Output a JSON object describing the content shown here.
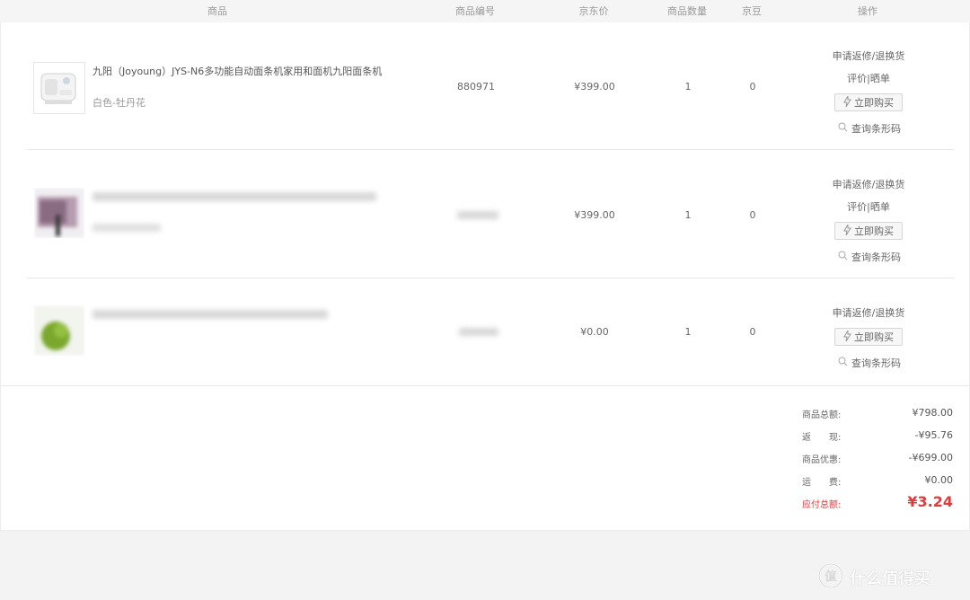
{
  "header": {
    "col_product": "商品",
    "col_sku": "商品编号",
    "col_price": "京东价",
    "col_qty": "商品数量",
    "col_jingdou": "京豆",
    "col_actions": "操作"
  },
  "rows": [
    {
      "title": "九阳（Joyoung）JYS-N6多功能自动面条机家用和面机九阳面条机",
      "spec": "白色-牡丹花",
      "sku": "880971",
      "price": "¥399.00",
      "qty": "1",
      "jingdou": "0",
      "return_label": "申请返修/退换货",
      "review_label": "评价|晒单",
      "buy_label": "立即购买",
      "barcode_label": "查询条形码"
    },
    {
      "title": "",
      "spec": "",
      "sku": "",
      "price": "¥399.00",
      "qty": "1",
      "jingdou": "0",
      "return_label": "申请返修/退换货",
      "review_label": "评价|晒单",
      "buy_label": "立即购买",
      "barcode_label": "查询条形码"
    },
    {
      "title": "",
      "sku": "",
      "price": "¥0.00",
      "qty": "1",
      "jingdou": "0",
      "return_label": "申请返修/退换货",
      "buy_label": "立即购买",
      "barcode_label": "查询条形码"
    }
  ],
  "summary": {
    "total_label": "商品总额:",
    "total_value": "¥798.00",
    "cashback_label": "返　　现:",
    "cashback_value": "-¥95.76",
    "discount_label": "商品优惠:",
    "discount_value": "-¥699.00",
    "shipping_label": "运　　费:",
    "shipping_value": "¥0.00",
    "payable_label": "应付总额:",
    "payable_value": "¥3.24"
  },
  "watermark": {
    "text": "什么值得买",
    "glyph": "值"
  },
  "colors": {
    "accent_red": "#e4393c",
    "page_bg": "#f3f3f3"
  },
  "icons": {
    "buy": "lightning-icon",
    "barcode": "search-icon",
    "logo": "smzdm-logo-icon"
  }
}
